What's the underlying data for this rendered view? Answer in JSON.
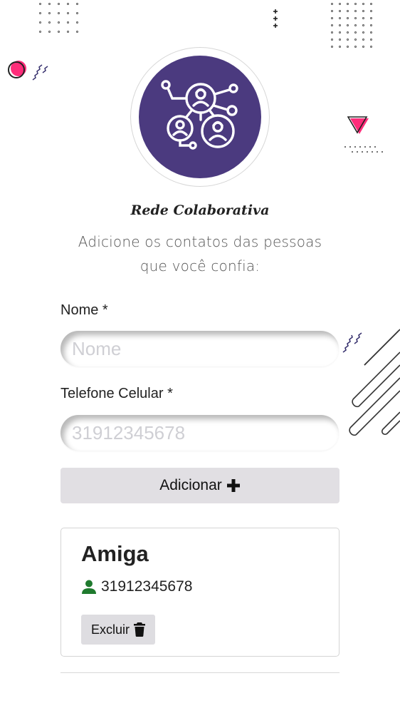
{
  "header": {
    "app_title": "Rede Colaborativa",
    "subtitle_line1": "Adicione os contatos das pessoas",
    "subtitle_line2": "que você confia:",
    "logo_icon": "network-people-icon"
  },
  "form": {
    "name_label": "Nome *",
    "name_placeholder": "Nome",
    "name_value": "",
    "phone_label": "Telefone Celular *",
    "phone_placeholder": "31912345678",
    "phone_value": "",
    "add_button_label": "Adicionar",
    "add_icon": "plus-icon"
  },
  "contacts": [
    {
      "name": "Amiga",
      "phone": "31912345678",
      "phone_icon": "user-icon",
      "delete_label": "Excluir",
      "delete_icon": "trash-icon"
    }
  ],
  "colors": {
    "brand_purple": "#4b3a7f",
    "accent_pink": "#ff2d7a",
    "button_gray": "#e1dfe3",
    "user_icon_green": "#1f7a2e"
  }
}
